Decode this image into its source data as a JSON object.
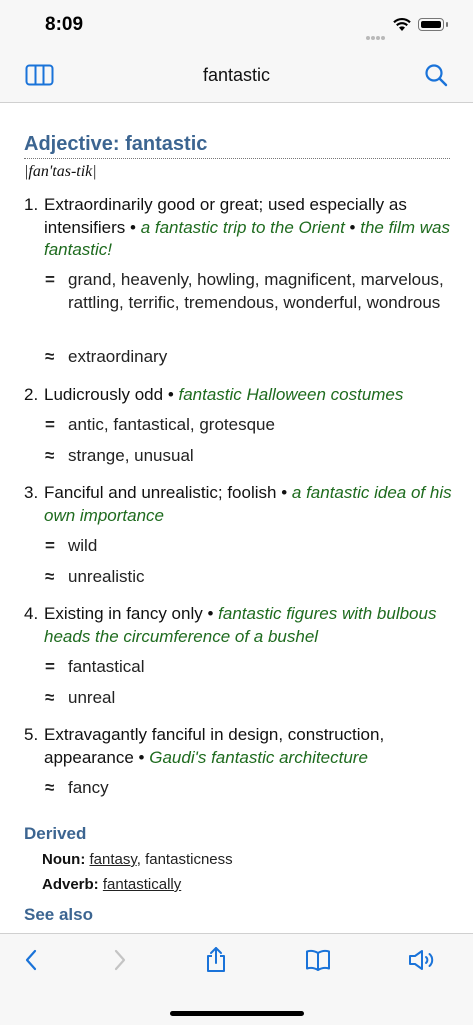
{
  "status": {
    "time": "8:09"
  },
  "nav": {
    "title": "fantastic"
  },
  "entry": {
    "heading": "Adjective: fantastic",
    "pronunciation": "|fan'tas-tik|",
    "senses": [
      {
        "num": "1.",
        "definition": "Extraordinarily good or great; used especially as intensifiers",
        "examples": [
          "a fantastic trip to the Orient",
          "the film was fantastic!"
        ],
        "synonyms": "grand, heavenly, howling, magnificent, marvelous, rattling, terrific, tremendous, wonderful, wondrous",
        "similar": "extraordinary"
      },
      {
        "num": "2.",
        "definition": "Ludicrously odd",
        "examples": [
          "fantastic Halloween costumes"
        ],
        "synonyms": "antic, fantastical, grotesque",
        "similar": "strange, unusual"
      },
      {
        "num": "3.",
        "definition": "Fanciful and unrealistic; foolish",
        "examples": [
          "a fantastic idea of his own importance"
        ],
        "synonyms": "wild",
        "similar": "unrealistic"
      },
      {
        "num": "4.",
        "definition": "Existing in fancy only",
        "examples": [
          "fantastic figures with bulbous heads the circumference of a bushel"
        ],
        "synonyms": "fantastical",
        "similar": "unreal"
      },
      {
        "num": "5.",
        "definition": "Extravagantly fanciful in design, construction, appearance",
        "examples": [
          "Gaudi's fantastic architecture"
        ],
        "similar": "fancy"
      }
    ],
    "symbols": {
      "synonym": "=",
      "similar": "≈",
      "bullet": "•"
    },
    "derived": {
      "title": "Derived",
      "noun_label": "Noun:",
      "noun_link": "fantasy",
      "noun_rest": ", fantasticness",
      "adverb_label": "Adverb:",
      "adverb_link": "fantastically"
    },
    "see_also": {
      "title": "See also"
    }
  },
  "icons": {
    "left_nav": "sidebar-icon",
    "right_nav": "search-icon",
    "toolbar": [
      "back-icon",
      "forward-icon",
      "share-icon",
      "bookmarks-icon",
      "speaker-icon"
    ]
  },
  "colors": {
    "accent": "#1a73d9",
    "heading": "#3c6591",
    "example": "#1e6b1e"
  }
}
